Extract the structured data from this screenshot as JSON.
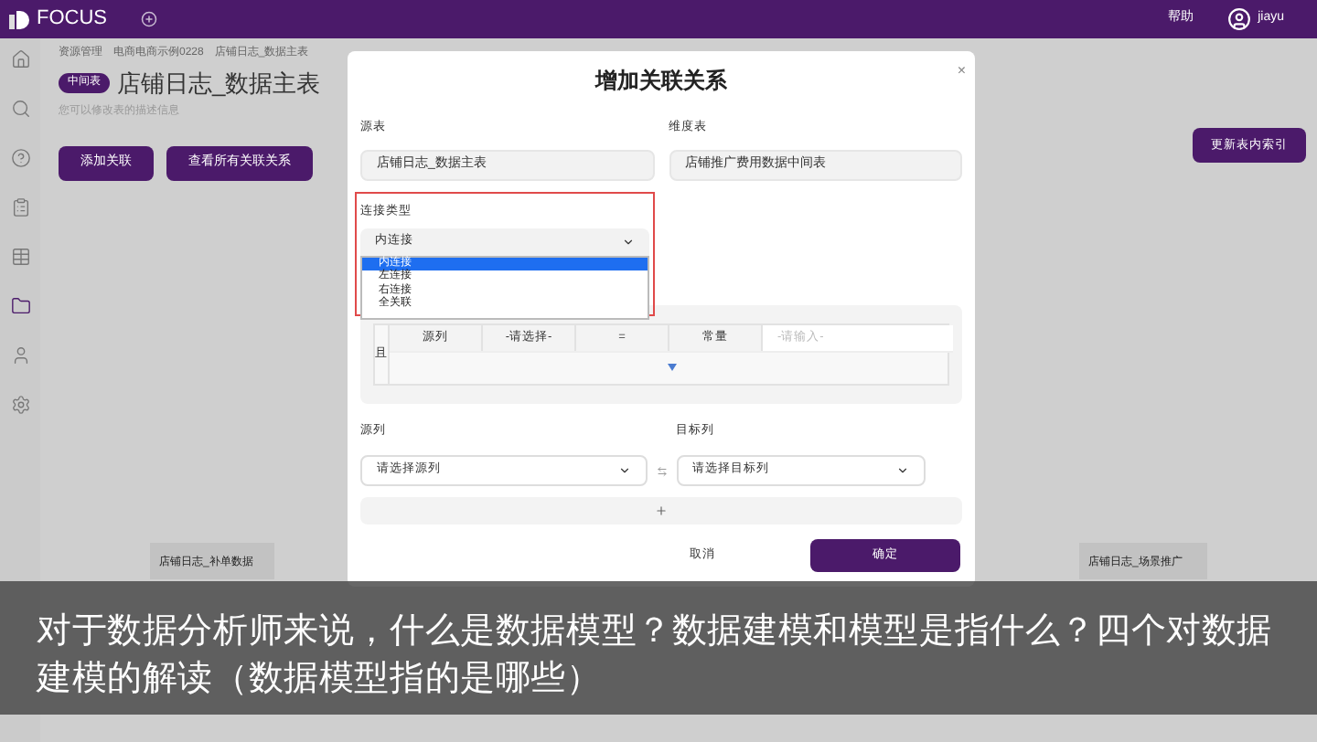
{
  "topbar": {
    "logo": "FOCUS",
    "help": "帮助",
    "user": "jiayu"
  },
  "sidebar": {
    "items": [
      {
        "kind": "home",
        "selected": false
      },
      {
        "kind": "search",
        "selected": false
      },
      {
        "kind": "help",
        "selected": false
      },
      {
        "kind": "clipboard",
        "selected": false
      },
      {
        "kind": "table",
        "selected": false
      },
      {
        "kind": "folder",
        "selected": true
      },
      {
        "kind": "user",
        "selected": false
      },
      {
        "kind": "settings",
        "selected": false
      }
    ]
  },
  "breadcrumb": [
    "资源管理",
    "电商电商示例0228",
    "店铺日志_数据主表"
  ],
  "page": {
    "tag": "中间表",
    "title": "店铺日志_数据主表",
    "subtitle": "您可以修改表的描述信息",
    "buttons": [
      "添加关联",
      "查看所有关联关系"
    ],
    "index_button": "更新表内索引",
    "cards": [
      "店铺日志_补单数据",
      "店铺日志_场景推广"
    ]
  },
  "dialog": {
    "title": "增加关联关系",
    "close": "×",
    "source_table": {
      "label": "源表",
      "value": "店铺日志_数据主表"
    },
    "dimension_table": {
      "label": "维度表",
      "value": "店铺推广费用数据中间表"
    },
    "join_type": {
      "label": "连接类型",
      "value": "内连接",
      "expanded": true,
      "options": [
        {
          "label": "内连接",
          "selected": true
        },
        {
          "label": "左连接",
          "selected": false
        },
        {
          "label": "右连接",
          "selected": false
        },
        {
          "label": "全关联",
          "selected": false
        }
      ]
    },
    "condition": {
      "logic": "且",
      "cells": [
        "源列",
        "-请选择-",
        "=",
        "常量"
      ],
      "placeholder": "-请输入-"
    },
    "source_column": {
      "label": "源列",
      "placeholder": "请选择源列"
    },
    "target_column": {
      "label": "目标列",
      "placeholder": "请选择目标列"
    },
    "buttons": [
      "取消",
      "确定"
    ]
  },
  "caption": "对于数据分析师来说，什么是数据模型？数据建模和模型是指什么？四个对数据建模的解读（数据模型指的是哪些）"
}
